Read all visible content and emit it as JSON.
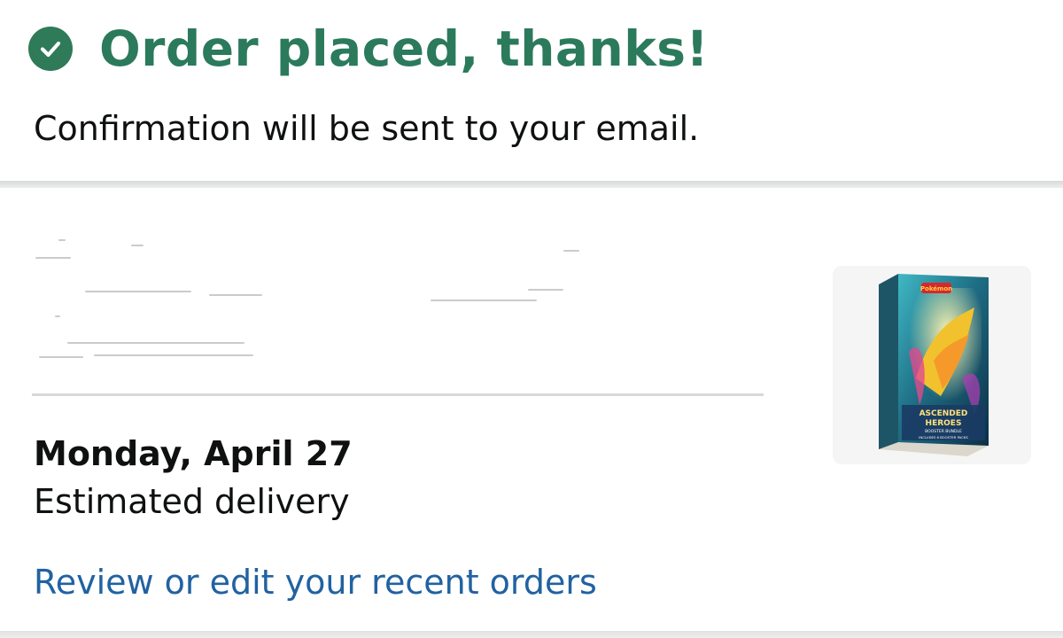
{
  "confirmation": {
    "title": "Order placed, thanks!",
    "subtitle": "Confirmation will be sent to your email.",
    "icon": "check-circle-icon",
    "accent_color": "#2b7a5c"
  },
  "delivery": {
    "date": "Monday, April 27",
    "label": "Estimated delivery"
  },
  "orders_link": {
    "label": "Review or edit your recent orders",
    "color": "#2162a1"
  },
  "product": {
    "box_lettering": [
      "Pokémon",
      "ASCENDED",
      "HEROES",
      "BOOSTER BUNDLE",
      "INCLUDES 6 BOOSTER PACKS"
    ]
  }
}
